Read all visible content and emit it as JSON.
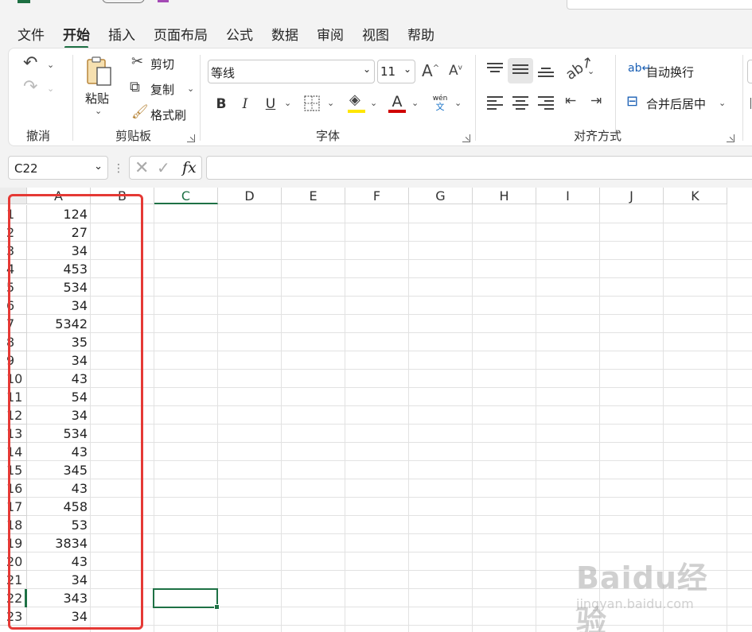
{
  "ribbon_tabs": [
    "文件",
    "开始",
    "插入",
    "页面布局",
    "公式",
    "数据",
    "审阅",
    "视图",
    "帮助"
  ],
  "active_tab_index": 1,
  "groups": {
    "undo": {
      "label": "撤消"
    },
    "clipboard": {
      "label": "剪贴板",
      "paste": "粘贴",
      "cut": "剪切",
      "copy": "复制",
      "format_painter": "格式刷"
    },
    "font": {
      "label": "字体",
      "font_name": "等线",
      "font_size": "11",
      "bold": "B",
      "italic": "I",
      "underline": "U",
      "font_color_glyph": "A",
      "phonetic_top": "wén",
      "phonetic_bottom": "文"
    },
    "alignment": {
      "label": "对齐方式",
      "wrap_text": "自动换行",
      "merge_center": "合并后居中"
    }
  },
  "formula_bar": {
    "name_box": "C22",
    "fx": "fx",
    "formula": ""
  },
  "columns": [
    "A",
    "B",
    "C",
    "D",
    "E",
    "F",
    "G",
    "H",
    "I",
    "J",
    "K"
  ],
  "selected_column": "C",
  "rows": [
    {
      "num": "1",
      "a": "124"
    },
    {
      "num": "2",
      "a": "27"
    },
    {
      "num": "3",
      "a": "34"
    },
    {
      "num": "4",
      "a": "453"
    },
    {
      "num": "5",
      "a": "534"
    },
    {
      "num": "6",
      "a": "34"
    },
    {
      "num": "7",
      "a": "5342"
    },
    {
      "num": "8",
      "a": "35"
    },
    {
      "num": "9",
      "a": "34"
    },
    {
      "num": "10",
      "a": "43"
    },
    {
      "num": "11",
      "a": "54"
    },
    {
      "num": "12",
      "a": "34"
    },
    {
      "num": "13",
      "a": "534"
    },
    {
      "num": "14",
      "a": "43"
    },
    {
      "num": "15",
      "a": "345"
    },
    {
      "num": "16",
      "a": "43"
    },
    {
      "num": "17",
      "a": "458"
    },
    {
      "num": "18",
      "a": "53"
    },
    {
      "num": "19",
      "a": "3834"
    },
    {
      "num": "20",
      "a": "43"
    },
    {
      "num": "21",
      "a": "34"
    },
    {
      "num": "22",
      "a": "343"
    },
    {
      "num": "23",
      "a": "34"
    }
  ],
  "watermark": {
    "main": "Baidu经验",
    "sub": "jingyan.baidu.com"
  },
  "colors": {
    "accent": "#1e7145",
    "highlight_box": "#e53935",
    "fill_yellow": "#ffe600",
    "font_red": "#d00000"
  }
}
